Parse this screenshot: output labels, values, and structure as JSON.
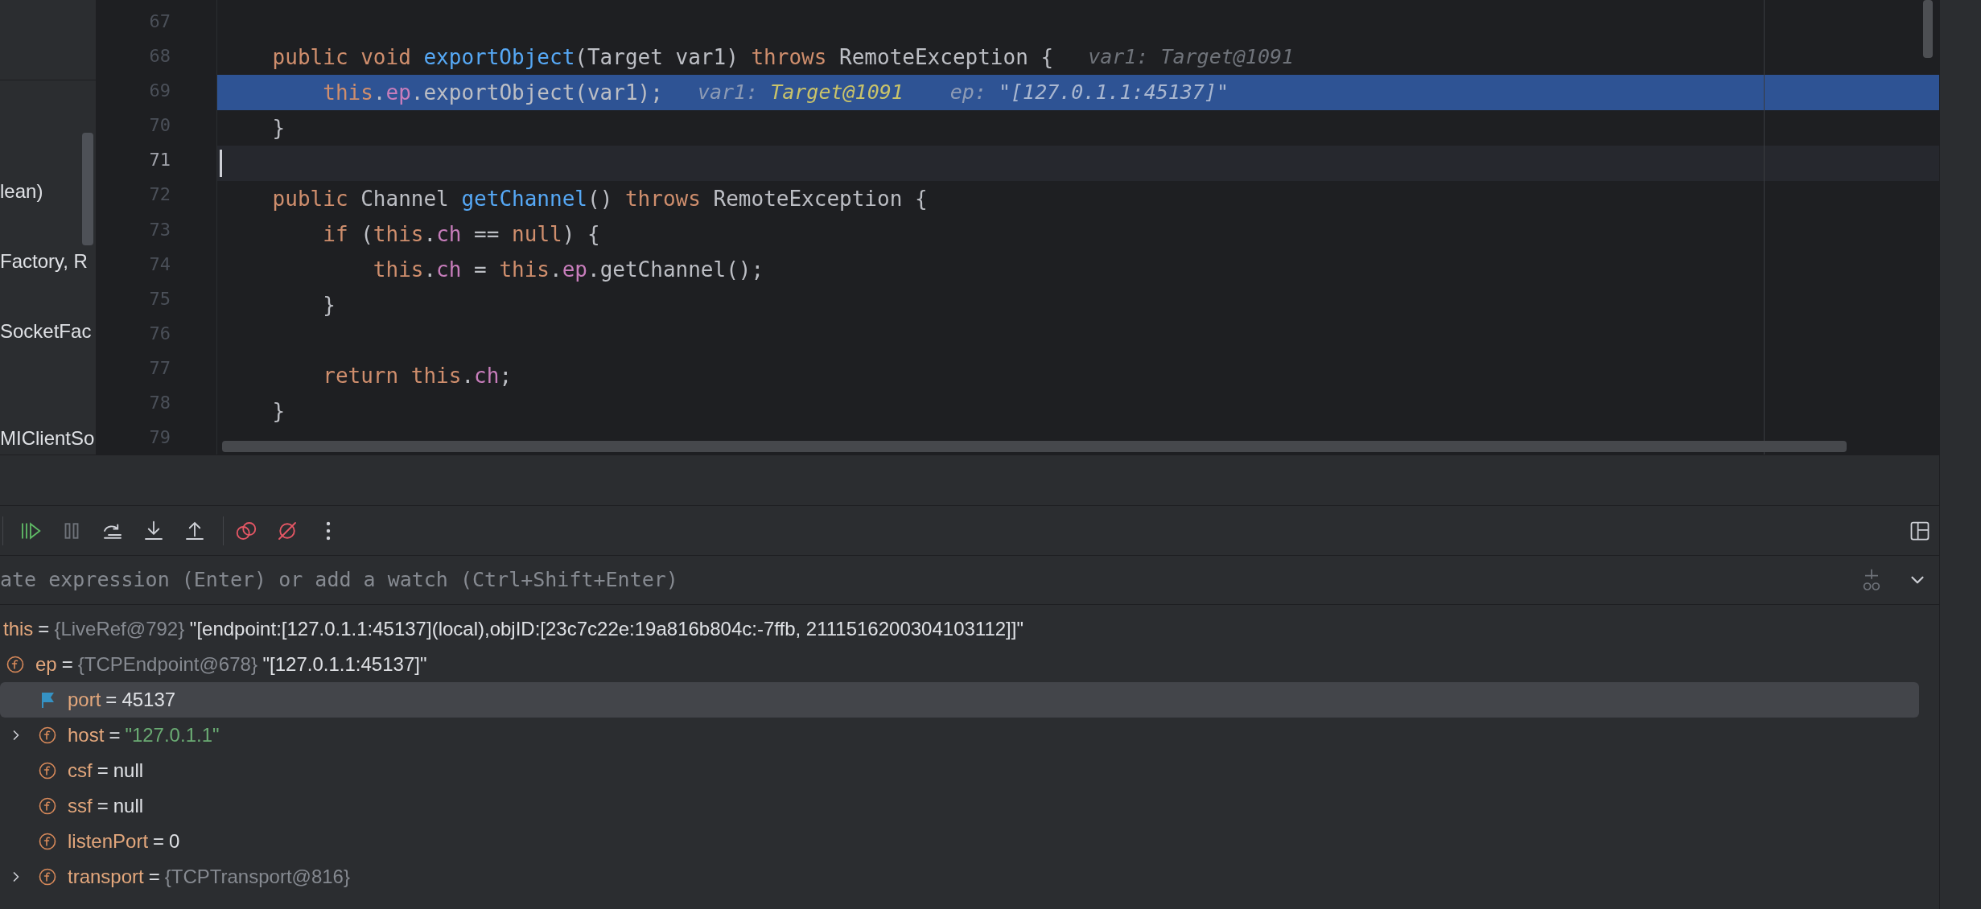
{
  "left_panel": {
    "items": [
      "lean)",
      "Factory, R",
      "SocketFac",
      "MIClientSo"
    ]
  },
  "editor": {
    "lines": [
      {
        "number": "67",
        "execution_point": false,
        "caret": false
      },
      {
        "number": "68",
        "execution_point": false,
        "caret": false,
        "tokens": [
          {
            "text": "    public void ",
            "kind": "keyword"
          },
          {
            "text": "exportObject",
            "kind": "method"
          },
          {
            "text": "(Target var1) ",
            "kind": "plain"
          },
          {
            "text": "throws",
            "kind": "keyword"
          },
          {
            "text": " RemoteException {",
            "kind": "plain"
          }
        ],
        "hints": [
          {
            "label": "var1:",
            "value": "Target@1091",
            "kind": "object"
          }
        ]
      },
      {
        "number": "69",
        "execution_point": true,
        "caret": false,
        "tokens": [
          {
            "text": "        this",
            "kind": "keyword"
          },
          {
            "text": ".",
            "kind": "plain"
          },
          {
            "text": "ep",
            "kind": "field"
          },
          {
            "text": ".exportObject(var1);",
            "kind": "plain"
          }
        ],
        "hints": [
          {
            "label": "var1:",
            "value": "Target@1091",
            "kind": "object"
          },
          {
            "label": "ep:",
            "value": "\"[127.0.1.1:45137]\"",
            "kind": "string"
          }
        ]
      },
      {
        "number": "70",
        "execution_point": false,
        "caret": false,
        "tokens": [
          {
            "text": "    }",
            "kind": "plain"
          }
        ]
      },
      {
        "number": "71",
        "execution_point": false,
        "caret": true
      },
      {
        "number": "72",
        "execution_point": false,
        "caret": false,
        "tokens": [
          {
            "text": "    public",
            "kind": "keyword"
          },
          {
            "text": " Channel ",
            "kind": "plain"
          },
          {
            "text": "getChannel",
            "kind": "method"
          },
          {
            "text": "() ",
            "kind": "plain"
          },
          {
            "text": "throws",
            "kind": "keyword"
          },
          {
            "text": " RemoteException {",
            "kind": "plain"
          }
        ]
      },
      {
        "number": "73",
        "execution_point": false,
        "caret": false,
        "tokens": [
          {
            "text": "        if",
            "kind": "keyword"
          },
          {
            "text": " (",
            "kind": "plain"
          },
          {
            "text": "this",
            "kind": "keyword"
          },
          {
            "text": ".",
            "kind": "plain"
          },
          {
            "text": "ch",
            "kind": "field"
          },
          {
            "text": " == ",
            "kind": "plain"
          },
          {
            "text": "null",
            "kind": "keyword"
          },
          {
            "text": ") {",
            "kind": "plain"
          }
        ]
      },
      {
        "number": "74",
        "execution_point": false,
        "caret": false,
        "tokens": [
          {
            "text": "            this",
            "kind": "keyword"
          },
          {
            "text": ".",
            "kind": "plain"
          },
          {
            "text": "ch",
            "kind": "field"
          },
          {
            "text": " = ",
            "kind": "plain"
          },
          {
            "text": "this",
            "kind": "keyword"
          },
          {
            "text": ".",
            "kind": "plain"
          },
          {
            "text": "ep",
            "kind": "field"
          },
          {
            "text": ".getChannel();",
            "kind": "plain"
          }
        ]
      },
      {
        "number": "75",
        "execution_point": false,
        "caret": false,
        "tokens": [
          {
            "text": "        }",
            "kind": "plain"
          }
        ]
      },
      {
        "number": "76",
        "execution_point": false,
        "caret": false
      },
      {
        "number": "77",
        "execution_point": false,
        "caret": false,
        "tokens": [
          {
            "text": "        return this",
            "kind": "keyword"
          },
          {
            "text": ".",
            "kind": "plain"
          },
          {
            "text": "ch",
            "kind": "field"
          },
          {
            "text": ";",
            "kind": "plain"
          }
        ]
      },
      {
        "number": "78",
        "execution_point": false,
        "caret": false,
        "tokens": [
          {
            "text": "    }",
            "kind": "plain"
          }
        ]
      },
      {
        "number": "79",
        "execution_point": false,
        "caret": false
      }
    ]
  },
  "debug_toolbar": {
    "buttons": [
      {
        "kind": "resume",
        "disabled": false
      },
      {
        "kind": "pause",
        "disabled": true
      },
      {
        "kind": "step_over",
        "disabled": false
      },
      {
        "kind": "step_into",
        "disabled": false
      },
      {
        "kind": "step_out",
        "disabled": false
      },
      {
        "kind": "view_breakpoints",
        "disabled": false
      },
      {
        "kind": "mute_breakpoints",
        "disabled": false
      },
      {
        "kind": "more",
        "disabled": false
      }
    ]
  },
  "evaluate_field": {
    "placeholder": "ate expression (Enter) or add a watch (Ctrl+Shift+Enter)"
  },
  "variables": [
    {
      "name": "this",
      "separator": "=",
      "type": "{LiveRef@792}",
      "value": "\"[endpoint:[127.0.1.1:45137](local),objID:[23c7c22e:19a816b804c:-7ffb, 2111516200304103112]]\"",
      "color": "#dfe1e5",
      "selected": false,
      "children": [
        {
          "kind": "field",
          "name": "ep",
          "separator": "=",
          "type": "{TCPEndpoint@678}",
          "value": "\"[127.0.1.1:45137]\"",
          "color": "#dfe1e5",
          "selected": false,
          "children": [
            {
              "kind": "flag",
              "name": "port",
              "separator": "=",
              "value": "45137",
              "color": "#dfe1e5",
              "selected": true
            },
            {
              "kind": "field",
              "name": "host",
              "separator": "=",
              "value": "\"127.0.1.1\"",
              "color": "#6aab73",
              "selected": false,
              "expanded": false
            },
            {
              "kind": "field",
              "name": "csf",
              "separator": "=",
              "value": "null",
              "color": "#dfe1e5",
              "selected": false
            },
            {
              "kind": "field",
              "name": "ssf",
              "separator": "=",
              "value": "null",
              "color": "#dfe1e5",
              "selected": false
            },
            {
              "kind": "field",
              "name": "listenPort",
              "separator": "=",
              "value": "0",
              "color": "#dfe1e5",
              "selected": false
            },
            {
              "kind": "field",
              "name": "transport",
              "separator": "=",
              "type": "{TCPTransport@816}",
              "selected": false,
              "expanded": false
            }
          ]
        }
      ]
    }
  ]
}
